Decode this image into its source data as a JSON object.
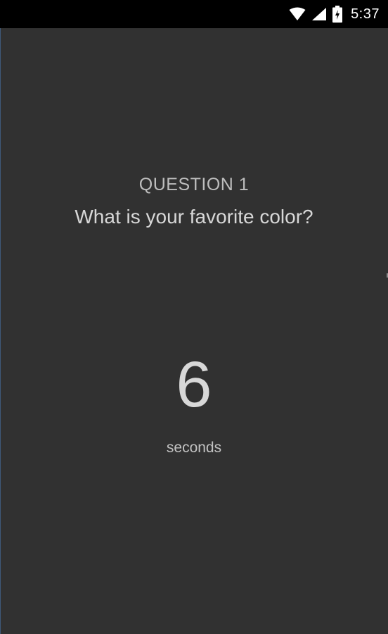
{
  "status_bar": {
    "time": "5:37",
    "icons": [
      "wifi-icon",
      "signal-icon",
      "battery-charging-icon"
    ]
  },
  "question": {
    "label": "QUESTION 1",
    "text": "What is your favorite color?"
  },
  "timer": {
    "value": "6",
    "unit": "seconds"
  },
  "colors": {
    "background": "#313131",
    "status_bar": "#000000",
    "text_primary": "#d7d7d7",
    "text_secondary": "#bdbdbd"
  }
}
